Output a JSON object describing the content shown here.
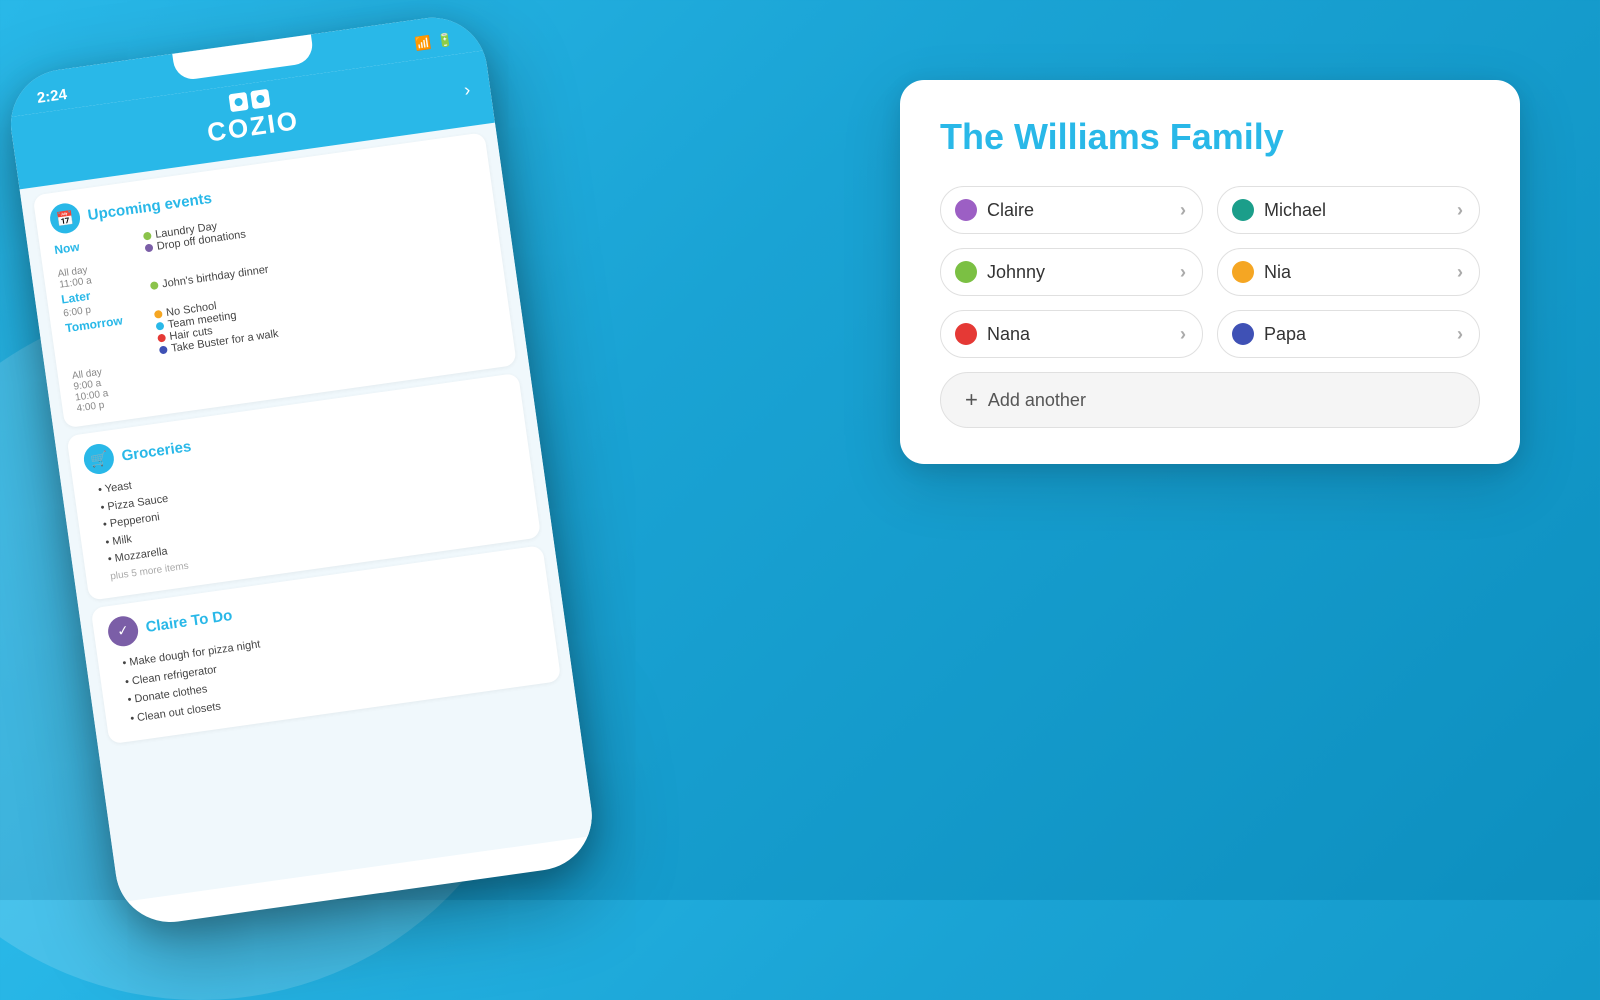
{
  "app": {
    "name": "Cozio",
    "logo_text": "COZIO",
    "time": "2:24"
  },
  "phone": {
    "sections": {
      "events": {
        "title": "Upcoming events",
        "icon": "📅",
        "now": {
          "label": "Now",
          "items": [
            {
              "time": "All day",
              "text": "Laundry Day",
              "color": "#8bc34a"
            },
            {
              "time": "11:00 a",
              "text": "Drop off donations",
              "color": "#7b5ea7"
            }
          ]
        },
        "later": {
          "label": "Later",
          "items": [
            {
              "time": "6:00 p",
              "text": "John's birthday dinner",
              "color": "#8bc34a"
            }
          ]
        },
        "tomorrow": {
          "label": "Tomorrow",
          "items": [
            {
              "time": "All day",
              "text": "No School"
            },
            {
              "time": "9:00 a",
              "text": "Team meeting"
            },
            {
              "time": "10:00 a",
              "text": "Hair cuts"
            },
            {
              "time": "4:00 p",
              "text": "Take Buster for a walk"
            }
          ]
        }
      },
      "groceries": {
        "title": "Groceries",
        "icon": "🛒",
        "items": [
          "Yeast",
          "Pizza Sauce",
          "Pepperoni",
          "Milk",
          "Mozzarella"
        ],
        "more": "plus 5 more items"
      },
      "todo": {
        "title": "Claire To Do",
        "items": [
          "Make dough for pizza night",
          "Clean refrigerator",
          "Donate clothes",
          "Clean out closets"
        ]
      }
    }
  },
  "family_card": {
    "title": "The Williams Family",
    "members": [
      {
        "name": "Claire",
        "color": "#9c5fc4",
        "id": "claire"
      },
      {
        "name": "Michael",
        "color": "#1b9e8a",
        "id": "michael"
      },
      {
        "name": "Johnny",
        "color": "#7bc043",
        "id": "johnny"
      },
      {
        "name": "Nia",
        "color": "#f5a623",
        "id": "nia"
      },
      {
        "name": "Nana",
        "color": "#e53935",
        "id": "nana"
      },
      {
        "name": "Papa",
        "color": "#3f51b5",
        "id": "papa"
      }
    ],
    "add_another": "Add another"
  }
}
